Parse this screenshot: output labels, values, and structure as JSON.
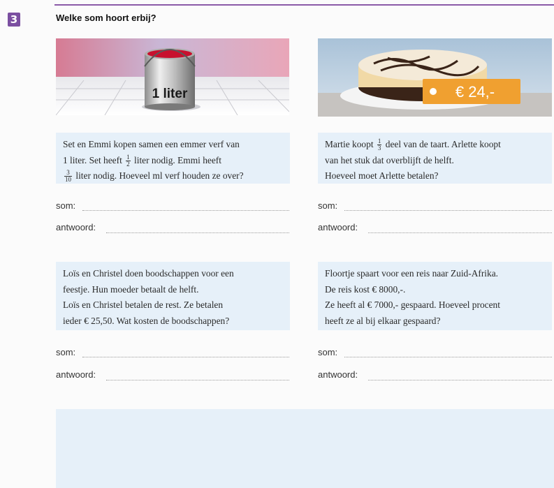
{
  "exercise": {
    "number": "3",
    "question": "Welke som hoort erbij?"
  },
  "images": {
    "paint_label": "1 liter",
    "price_tag": "€ 24,-"
  },
  "problems": [
    {
      "line1": "Set en Emmi kopen samen een emmer verf van",
      "line2_a": "1 liter. Set heeft",
      "line2_frac_num": "1",
      "line2_frac_den": "2",
      "line2_b": "liter nodig. Emmi heeft",
      "line3_frac_num": "3",
      "line3_frac_den": "10",
      "line3_b": "liter nodig. Hoeveel ml verf houden ze over?"
    },
    {
      "line1_a": "Martie koopt",
      "line1_frac_num": "1",
      "line1_frac_den": "3",
      "line1_b": "deel van de taart. Arlette koopt",
      "line2": "van het stuk dat overblijft de helft.",
      "line3": "Hoeveel moet Arlette betalen?"
    },
    {
      "line1": "Loïs en Christel doen boodschappen voor een",
      "line2": "feestje. Hun moeder betaalt de helft.",
      "line3": "Loïs en Christel betalen de rest. Ze betalen",
      "line4": "ieder € 25,50. Wat kosten de boodschappen?"
    },
    {
      "line1": "Floortje spaart voor een reis naar Zuid-Afrika.",
      "line2": "De reis kost € 8000,-.",
      "line3": "Ze heeft al € 7000,- gespaard. Hoeveel procent",
      "line4": "heeft ze al bij elkaar gespaard?"
    }
  ],
  "labels": {
    "som": "som:",
    "antwoord": "antwoord:"
  },
  "colors": {
    "accent_purple": "#7b4fa1",
    "box_blue": "#e6f0f9",
    "price_orange": "#f0a030",
    "paint_red": "#c8102e"
  }
}
